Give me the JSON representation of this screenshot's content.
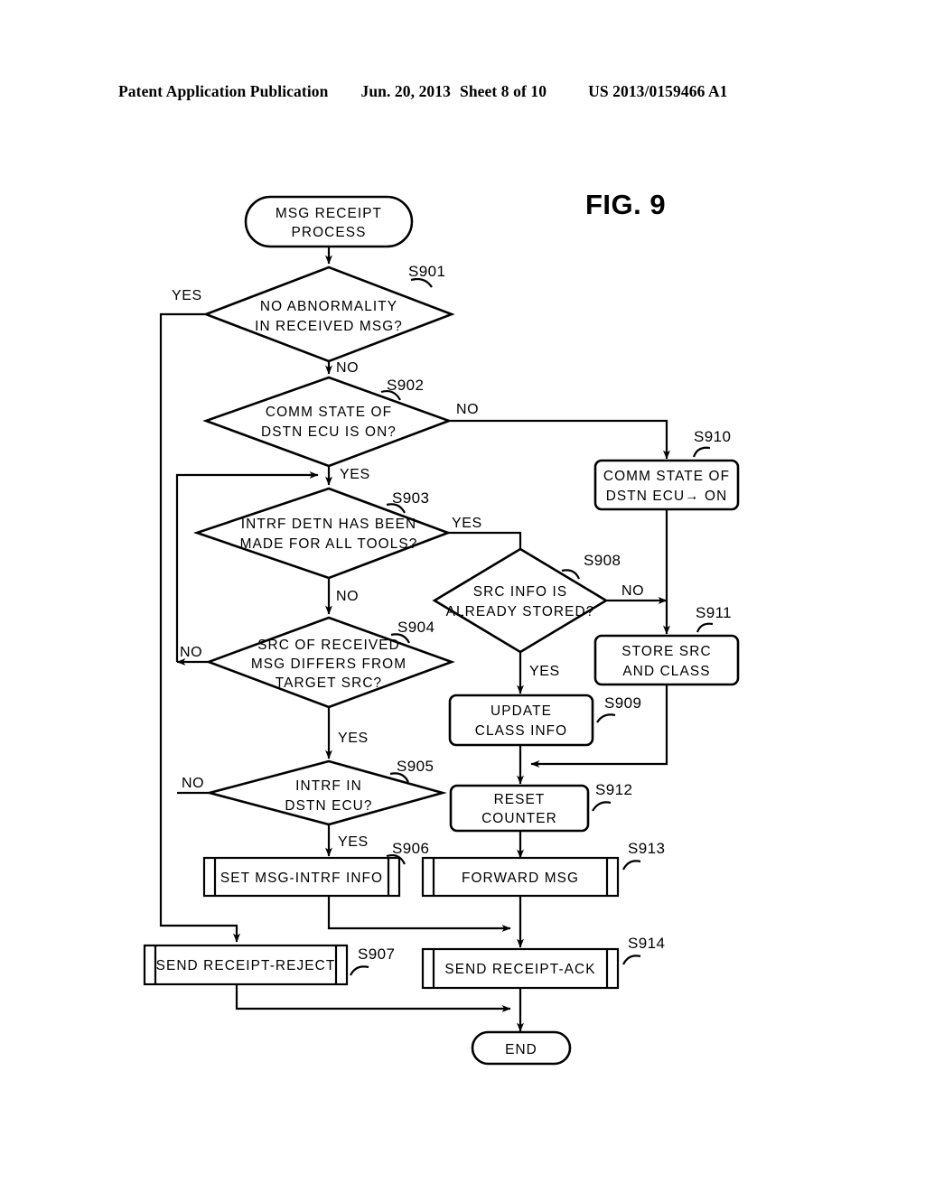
{
  "header": {
    "publication": "Patent Application Publication",
    "date": "Jun. 20, 2013",
    "sheet": "Sheet 8 of 10",
    "doc_number": "US 2013/0159466 A1"
  },
  "figure": {
    "label": "FIG. 9"
  },
  "flowchart": {
    "start": {
      "id": "start",
      "text_line1": "MSG RECEIPT",
      "text_line2": "PROCESS"
    },
    "end": {
      "id": "end",
      "text_line1": "END"
    },
    "steps": [
      {
        "id": "S901",
        "tag": "S901",
        "type": "decision",
        "text_line1": "NO ABNORMALITY",
        "text_line2": "IN RECEIVED MSG?",
        "yes_label": "YES",
        "no_label": "NO"
      },
      {
        "id": "S902",
        "tag": "S902",
        "type": "decision",
        "text_line1": "COMM STATE OF",
        "text_line2": "DSTN ECU IS ON?",
        "yes_label": "YES",
        "no_label": "NO"
      },
      {
        "id": "S903",
        "tag": "S903",
        "type": "decision",
        "text_line1": "INTRF DETN HAS BEEN",
        "text_line2": "MADE FOR ALL TOOLS?",
        "yes_label": "YES",
        "no_label": "NO"
      },
      {
        "id": "S904",
        "tag": "S904",
        "type": "decision",
        "text_line1": "SRC OF RECEIVED",
        "text_line2": "MSG DIFFERS FROM",
        "text_line3": "TARGET SRC?",
        "yes_label": "YES",
        "no_label": "NO"
      },
      {
        "id": "S905",
        "tag": "S905",
        "type": "decision",
        "text_line1": "INTRF IN",
        "text_line2": "DSTN ECU?",
        "yes_label": "YES",
        "no_label": "NO"
      },
      {
        "id": "S906",
        "tag": "S906",
        "type": "predefined-process",
        "text_line1": "SET MSG-INTRF INFO"
      },
      {
        "id": "S907",
        "tag": "S907",
        "type": "predefined-process",
        "text_line1": "SEND RECEIPT-REJECT"
      },
      {
        "id": "S908",
        "tag": "S908",
        "type": "decision",
        "text_line1": "SRC INFO IS",
        "text_line2": "ALREADY STORED?",
        "yes_label": "YES",
        "no_label": "NO"
      },
      {
        "id": "S909",
        "tag": "S909",
        "type": "process",
        "text_line1": "UPDATE",
        "text_line2": "CLASS INFO"
      },
      {
        "id": "S910",
        "tag": "S910",
        "type": "process",
        "text_line1": "COMM STATE OF",
        "text_line2": "DSTN ECU→ ON"
      },
      {
        "id": "S911",
        "tag": "S911",
        "type": "process",
        "text_line1": "STORE SRC",
        "text_line2": "AND CLASS"
      },
      {
        "id": "S912",
        "tag": "S912",
        "type": "process",
        "text_line1": "RESET",
        "text_line2": "COUNTER"
      },
      {
        "id": "S913",
        "tag": "S913",
        "type": "predefined-process",
        "text_line1": "FORWARD MSG"
      },
      {
        "id": "S914",
        "tag": "S914",
        "type": "predefined-process",
        "text_line1": "SEND RECEIPT-ACK"
      }
    ],
    "branch_markers": {
      "s901_yes": "YES",
      "s901_no": "NO",
      "s902_no": "NO",
      "s902_yes": "YES",
      "s903_yes": "YES",
      "s903_no": "NO",
      "s904_no": "NO",
      "s904_yes": "YES",
      "s905_no": "NO",
      "s905_yes": "YES",
      "s908_no": "NO",
      "s908_yes": "YES"
    }
  }
}
